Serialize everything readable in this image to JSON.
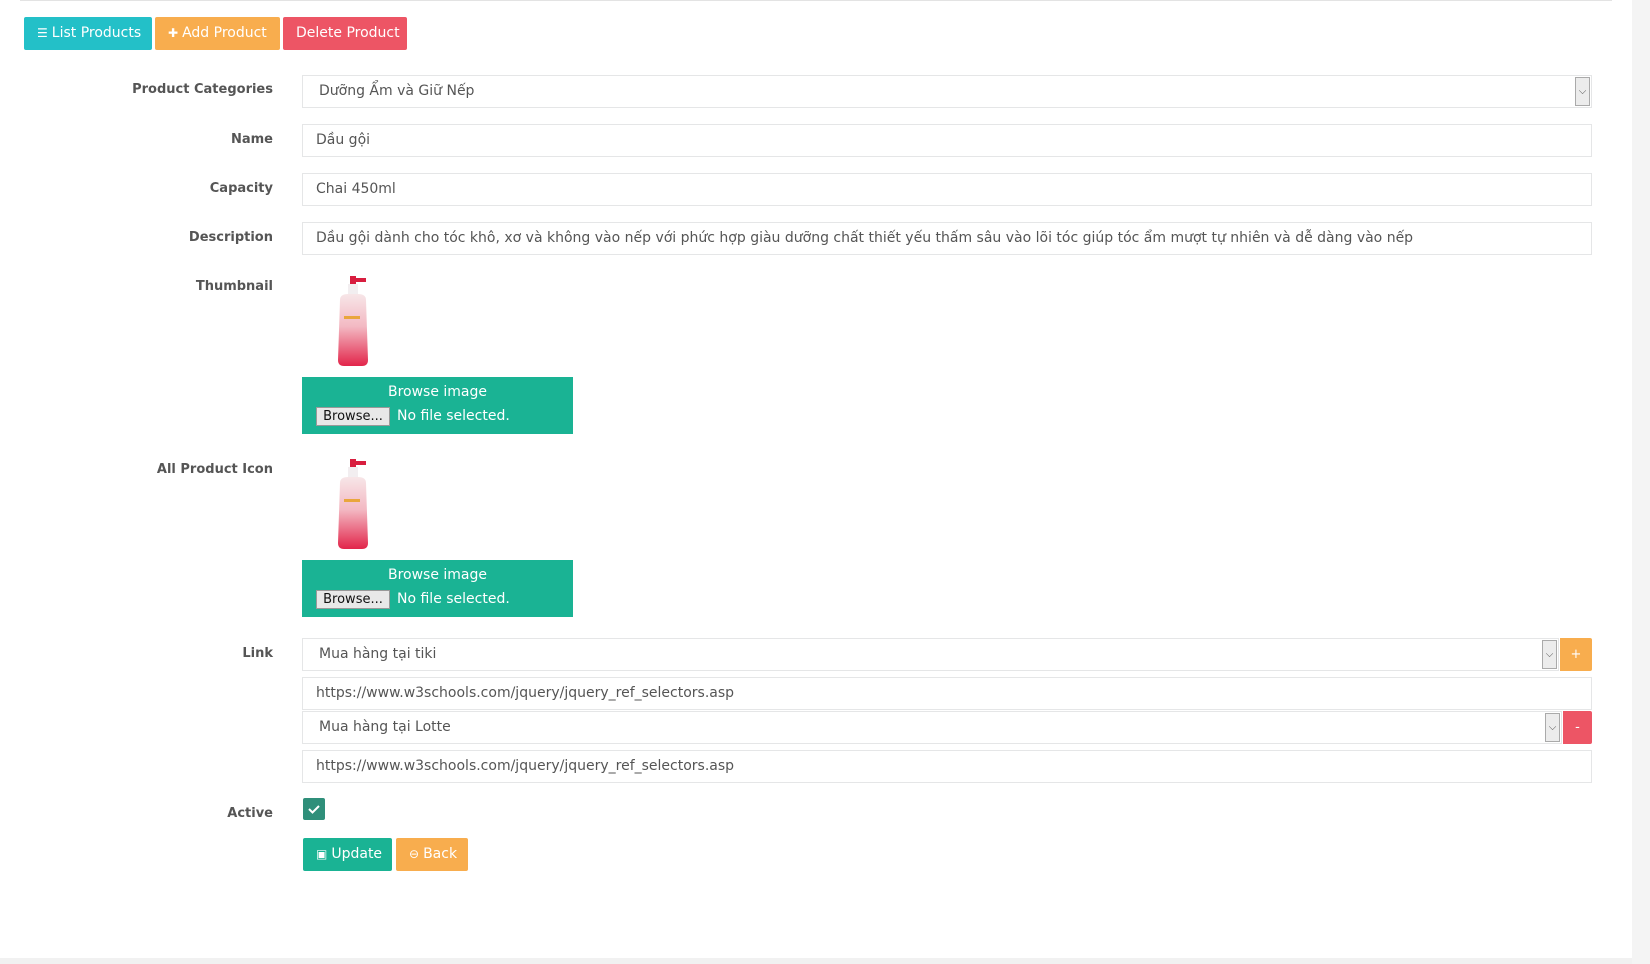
{
  "toolbar": {
    "list_label": "List Products",
    "add_label": "Add Product",
    "delete_label": "Delete Product"
  },
  "form": {
    "category": {
      "label": "Product Categories",
      "value": "Dưỡng Ẩm và Giữ Nếp"
    },
    "name": {
      "label": "Name",
      "value": "Dầu gội"
    },
    "capacity": {
      "label": "Capacity",
      "value": "Chai 450ml"
    },
    "description": {
      "label": "Description",
      "value": "Dầu gội dành cho tóc khô, xơ và không vào nếp với phức hợp giàu dưỡng chất thiết yếu thấm sâu vào lõi tóc giúp tóc ẩm mượt tự nhiên và dễ dàng vào nếp"
    },
    "thumbnail": {
      "label": "Thumbnail",
      "browse_title": "Browse image",
      "browse_button": "Browse...",
      "status": "No file selected."
    },
    "all_icon": {
      "label": "All Product Icon",
      "browse_title": "Browse image",
      "browse_button": "Browse...",
      "status": "No file selected."
    },
    "link": {
      "label": "Link",
      "add_symbol": "+",
      "remove_symbol": "-",
      "entries": [
        {
          "store": "Mua hàng tại tiki",
          "url": "https://www.w3schools.com/jquery/jquery_ref_selectors.asp"
        },
        {
          "store": "Mua hàng tại Lotte",
          "url": "https://www.w3schools.com/jquery/jquery_ref_selectors.asp"
        }
      ]
    },
    "active": {
      "label": "Active",
      "checked": true
    }
  },
  "actions": {
    "update_label": "Update",
    "back_label": "Back"
  },
  "colors": {
    "teal": "#23c0c8",
    "orange": "#f8ad4e",
    "red": "#ed5565",
    "green": "#1ab394"
  },
  "icons": {
    "list": "list-icon",
    "plus": "plus-icon",
    "save": "save-icon",
    "back": "back-circle-icon",
    "check": "check-icon"
  }
}
